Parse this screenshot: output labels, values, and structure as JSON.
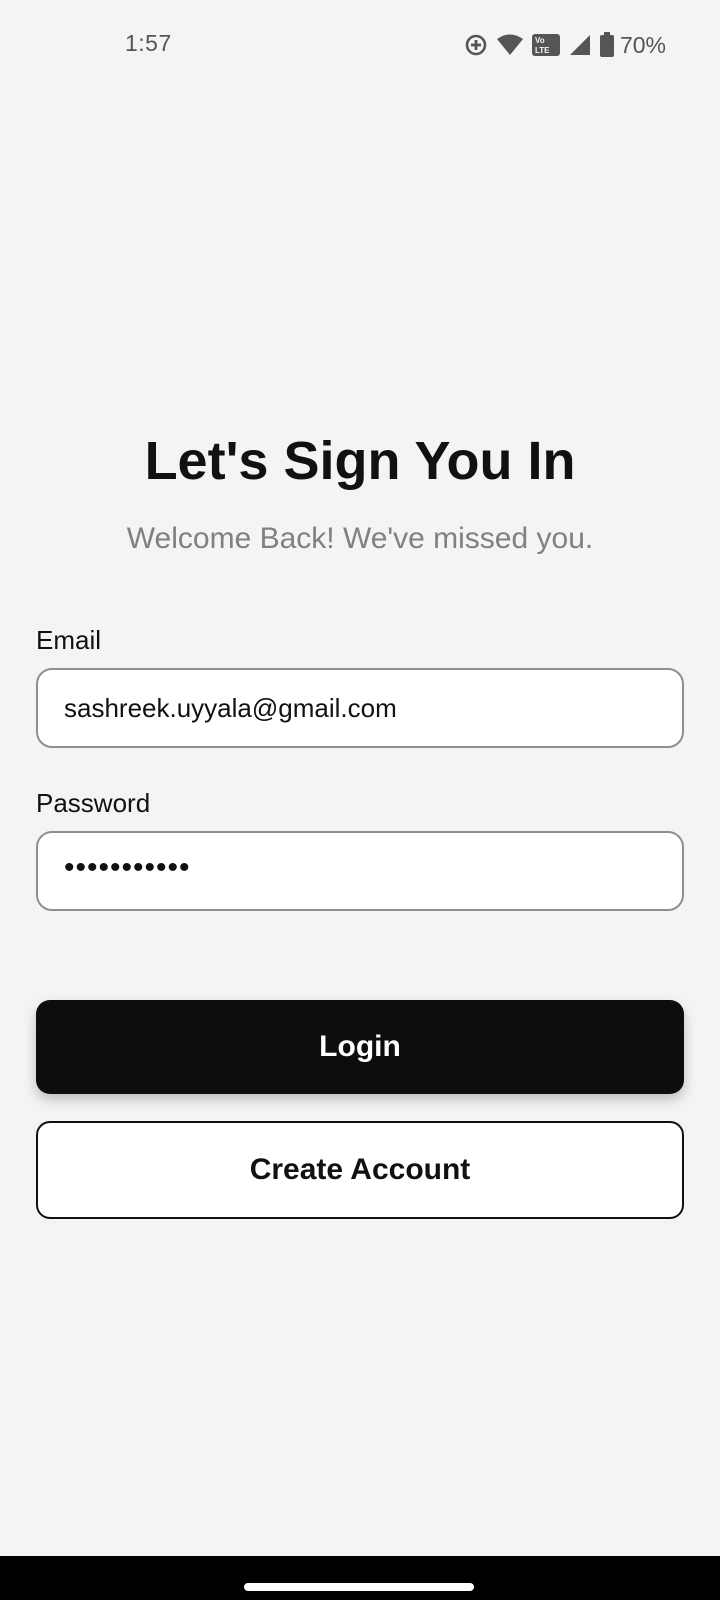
{
  "status_bar": {
    "time": "1:57",
    "battery_percent": "70%",
    "icons": [
      "data-saver-icon",
      "wifi-icon",
      "volte-icon",
      "cell-signal-icon",
      "battery-icon"
    ],
    "volte_text_top": "Vo",
    "volte_text_bottom": "LTE"
  },
  "login": {
    "title": "Let's Sign You In",
    "subtitle": "Welcome Back! We've missed you.",
    "email_label": "Email",
    "email_value": "sashreek.uyyala@gmail.com",
    "password_label": "Password",
    "password_value": "•••••••••••",
    "login_label": "Login",
    "create_account_label": "Create Account"
  },
  "colors": {
    "background": "#f4f4f4",
    "primary_button": "#0f0d0c",
    "subtitle_text": "#808080",
    "input_border": "#8f8f8f"
  }
}
